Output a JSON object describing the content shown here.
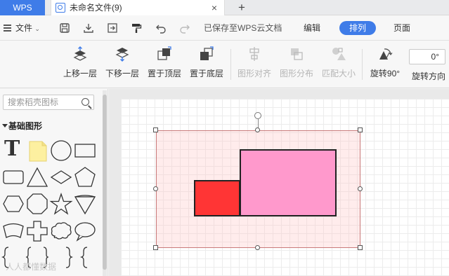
{
  "tabs": {
    "app": "WPS",
    "document": "未命名文件(9)",
    "close_glyph": "×",
    "add_glyph": "+"
  },
  "menubar": {
    "file": "文件",
    "saved_status": "已保存至WPS云文档",
    "edit": "编辑",
    "arrange": "排列",
    "page": "页面"
  },
  "toolbar": {
    "move_up": "上移一层",
    "move_down": "下移一层",
    "bring_to_top": "置于顶层",
    "send_to_bottom": "置于底层",
    "align": "图形对齐",
    "distribute": "图形分布",
    "match_size": "匹配大小",
    "rotate_90": "旋转90°",
    "rotate_direction": "旋转方向",
    "rotation_value": "0°"
  },
  "leftpanel": {
    "search_placeholder": "搜索稻壳图标",
    "section_title": "基础图形",
    "text_shape": "T"
  },
  "watermark": "人人都懂数据",
  "colors": {
    "accent": "#3f7ce8",
    "group_fill": "#ffe6e6",
    "red_rect": "#ff3535",
    "pink_rect": "#ff99cc"
  }
}
